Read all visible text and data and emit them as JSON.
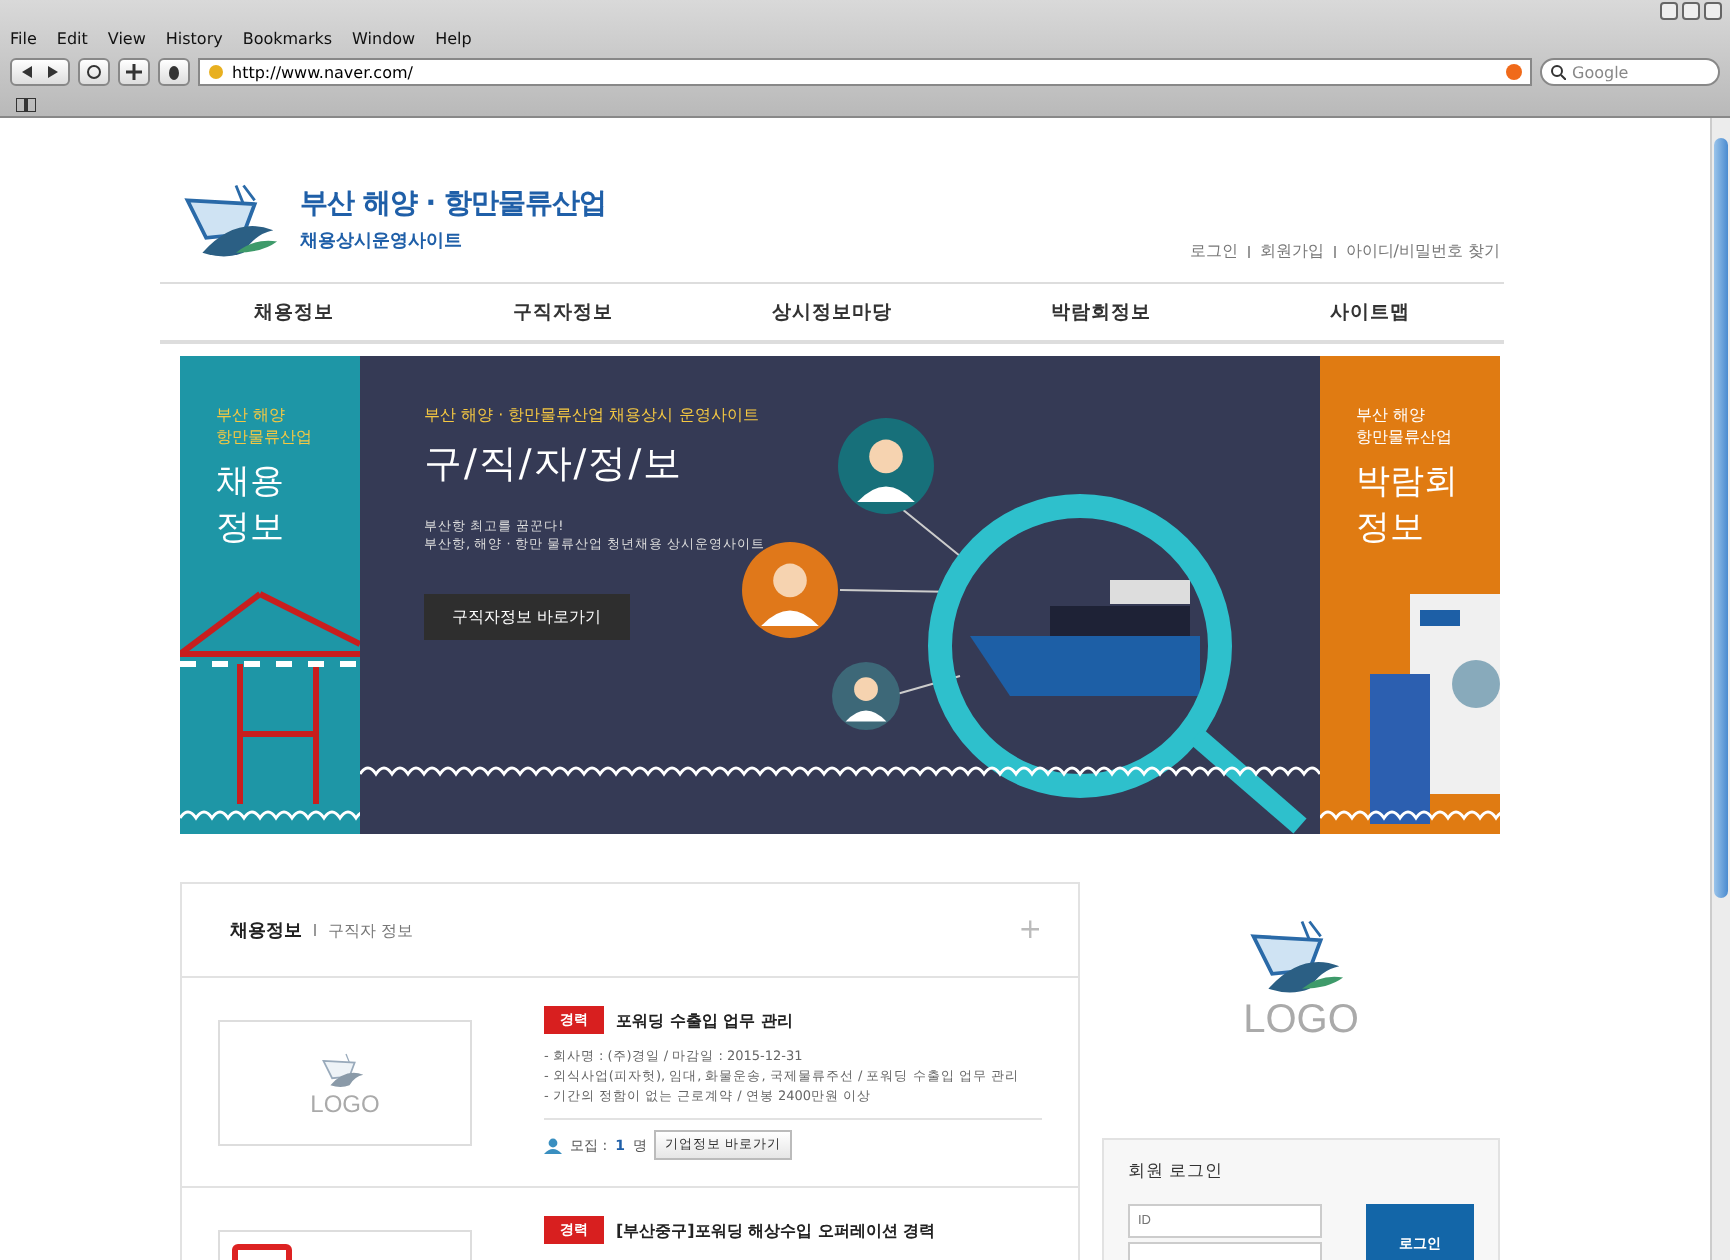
{
  "browser": {
    "menu": [
      "File",
      "Edit",
      "View",
      "History",
      "Bookmarks",
      "Window",
      "Help"
    ],
    "url": "http://www.naver.com/",
    "search_placeholder": "Google"
  },
  "header": {
    "brand_title": "부산 해양 · 항만물류산업",
    "brand_subtitle": "채용상시운영사이트",
    "util_links": [
      "로그인",
      "회원가입",
      "아이디/비밀번호 찾기"
    ]
  },
  "nav": [
    {
      "label": "채용정보"
    },
    {
      "label": "구직자정보"
    },
    {
      "label": "상시정보마당"
    },
    {
      "label": "박람회정보"
    },
    {
      "label": "사이트맵"
    }
  ],
  "banner": {
    "left": {
      "subtitle_lines": [
        "부산 해양",
        "항만물류산업"
      ],
      "title_lines": [
        "채용",
        "정보"
      ]
    },
    "center": {
      "eyebrow": "부산 해양 · 항만물류산업 채용상시 운영사이트",
      "title": "구/직/자/정/보",
      "description_lines": [
        "부산항 최고를 꿈꾼다!",
        "부산항, 해양 · 항만 물류산업 청년채용 상시운영사이트"
      ],
      "button": "구직자정보 바로가기"
    },
    "right": {
      "subtitle_lines": [
        "부산 해양",
        "항만물류산업"
      ],
      "title_lines": [
        "박람회",
        "정보"
      ]
    }
  },
  "jobs": {
    "tabs": [
      {
        "label": "채용정보",
        "selected": true
      },
      {
        "label": "구직자 정보",
        "selected": false
      }
    ],
    "more": "+",
    "items": [
      {
        "badge": "경력",
        "title": "포워딩 수출입 업무 관리",
        "logo": "LOGO",
        "details": [
          "- 회사명 : (주)경일 / 마감일 : 2015-12-31",
          "- 외식사업(피자헛), 임대, 화물운송, 국제물류주선 / 포워딩 수출입 업무 관리",
          "- 기간의 정함이 없는 근로계약 / 연봉 2400만원 이상"
        ],
        "recruit_label": "모집 :",
        "recruit_count": "1",
        "recruit_unit": "명",
        "company_button": "기업정보 바로가기"
      },
      {
        "badge": "경력",
        "title": "[부산중구]포워딩 해상수입 오퍼레이션 경력"
      }
    ]
  },
  "sidebar": {
    "logo": "LOGO",
    "login": {
      "title": "회원 로그인",
      "id_placeholder": "ID",
      "button": "로그인"
    }
  }
}
